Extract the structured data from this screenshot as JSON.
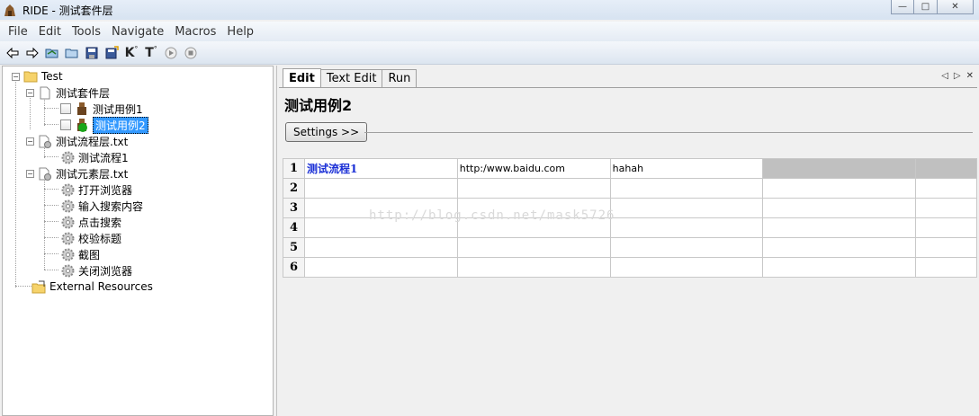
{
  "window": {
    "title": "RIDE - 测试套件层",
    "controls": {
      "minimize": "—",
      "maximize": "□",
      "close": "✕"
    }
  },
  "menu": [
    "File",
    "Edit",
    "Tools",
    "Navigate",
    "Macros",
    "Help"
  ],
  "toolbar": {
    "buttons": [
      "back-arrow-icon",
      "forward-arrow-icon",
      "open-folder-icon",
      "open-directory-icon",
      "save-icon",
      "save-all-icon",
      "search-keywords-icon",
      "search-tests-icon",
      "run-icon",
      "stop-icon"
    ],
    "k_label": "K",
    "t_label": "T"
  },
  "tree": {
    "root": "Test",
    "suite": "测试套件层",
    "case1": "测试用例1",
    "case2": "测试用例2",
    "flow_file": "测试流程层.txt",
    "flow1": "测试流程1",
    "elements_file": "测试元素层.txt",
    "kw1": "打开浏览器",
    "kw2": "输入搜索内容",
    "kw3": "点击搜索",
    "kw4": "校验标题",
    "kw5": "截图",
    "kw6": "关闭浏览器",
    "external": "External Resources"
  },
  "tabs": [
    "Edit",
    "Text Edit",
    "Run"
  ],
  "editor": {
    "title": "测试用例2",
    "settings_label": "Settings >>",
    "rows": [
      {
        "num": "1",
        "cells": [
          "测试流程1",
          "http:/www.baidu.com",
          "hahah",
          "",
          ""
        ]
      },
      {
        "num": "2",
        "cells": [
          "",
          "",
          "",
          "",
          ""
        ]
      },
      {
        "num": "3",
        "cells": [
          "",
          "",
          "",
          "",
          ""
        ]
      },
      {
        "num": "4",
        "cells": [
          "",
          "",
          "",
          "",
          ""
        ]
      },
      {
        "num": "5",
        "cells": [
          "",
          "",
          "",
          "",
          ""
        ]
      },
      {
        "num": "6",
        "cells": [
          "",
          "",
          "",
          "",
          ""
        ]
      }
    ]
  },
  "watermark": "http://blog.csdn.net/mask5726"
}
